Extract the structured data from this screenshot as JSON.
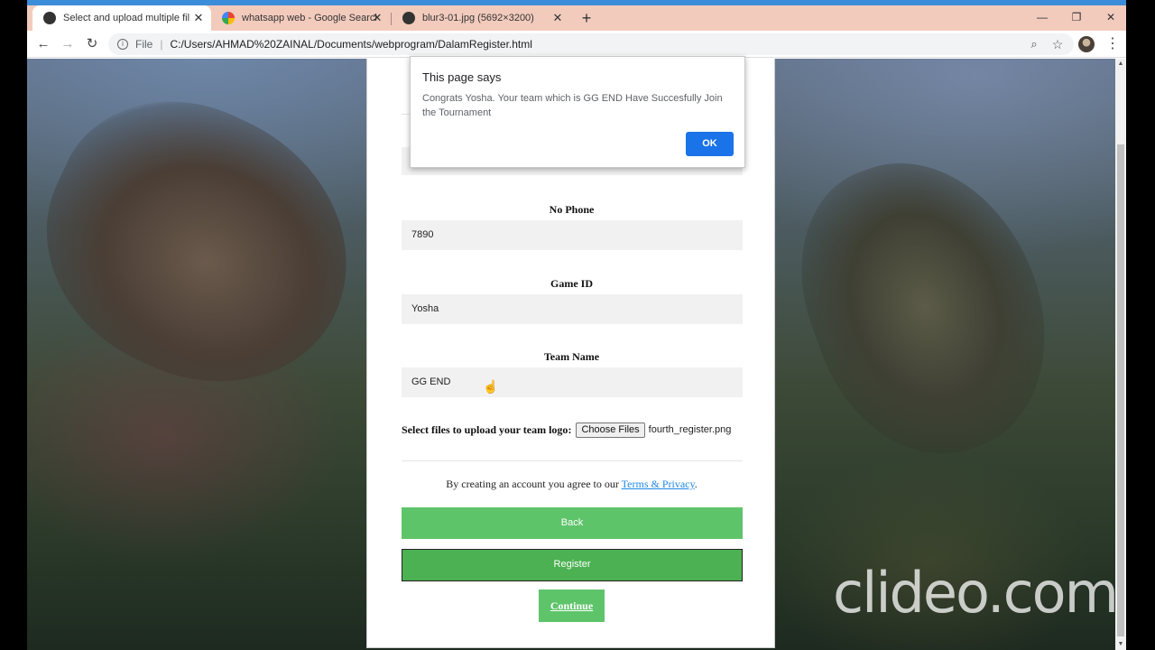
{
  "tabs": [
    {
      "title": "Select and upload multiple files t",
      "active": true,
      "favicon": "web-globe-icon"
    },
    {
      "title": "whatsapp web - Google Search",
      "active": false,
      "favicon": "google-g-icon"
    },
    {
      "title": "blur3-01.jpg (5692×3200)",
      "active": false,
      "favicon": "web-globe-icon"
    }
  ],
  "address": {
    "scheme": "File",
    "url": "C:/Users/AHMAD%20ZAINAL/Documents/webprogram/DalamRegister.html"
  },
  "form": {
    "phone_label": "No Phone",
    "phone_value": "7890",
    "game_id_label": "Game ID",
    "game_id_value": "Yosha",
    "team_name_label": "Team Name",
    "team_name_value": "GG END",
    "upload_label": "Select files to upload your team logo",
    "upload_colon": ":",
    "choose_files": "Choose Files",
    "file_name": "fourth_register.png",
    "terms_prefix": "By creating an account you agree to our ",
    "terms_link": "Terms & Privacy",
    "terms_suffix": ".",
    "back_label": "Back",
    "register_label": "Register",
    "continue_label": "Continue"
  },
  "dialog": {
    "title": "This page says",
    "message": "Congrats Yosha. Your team which is GG END Have Succesfully Join the Tournament",
    "ok_label": "OK"
  },
  "watermark": "clideo.com",
  "colors": {
    "tab_bar": "#f2cbbd",
    "button_green": "#5ec46a",
    "register_green": "#4cb152",
    "dialog_ok": "#1a73e8",
    "link_blue": "#1e88e5"
  }
}
